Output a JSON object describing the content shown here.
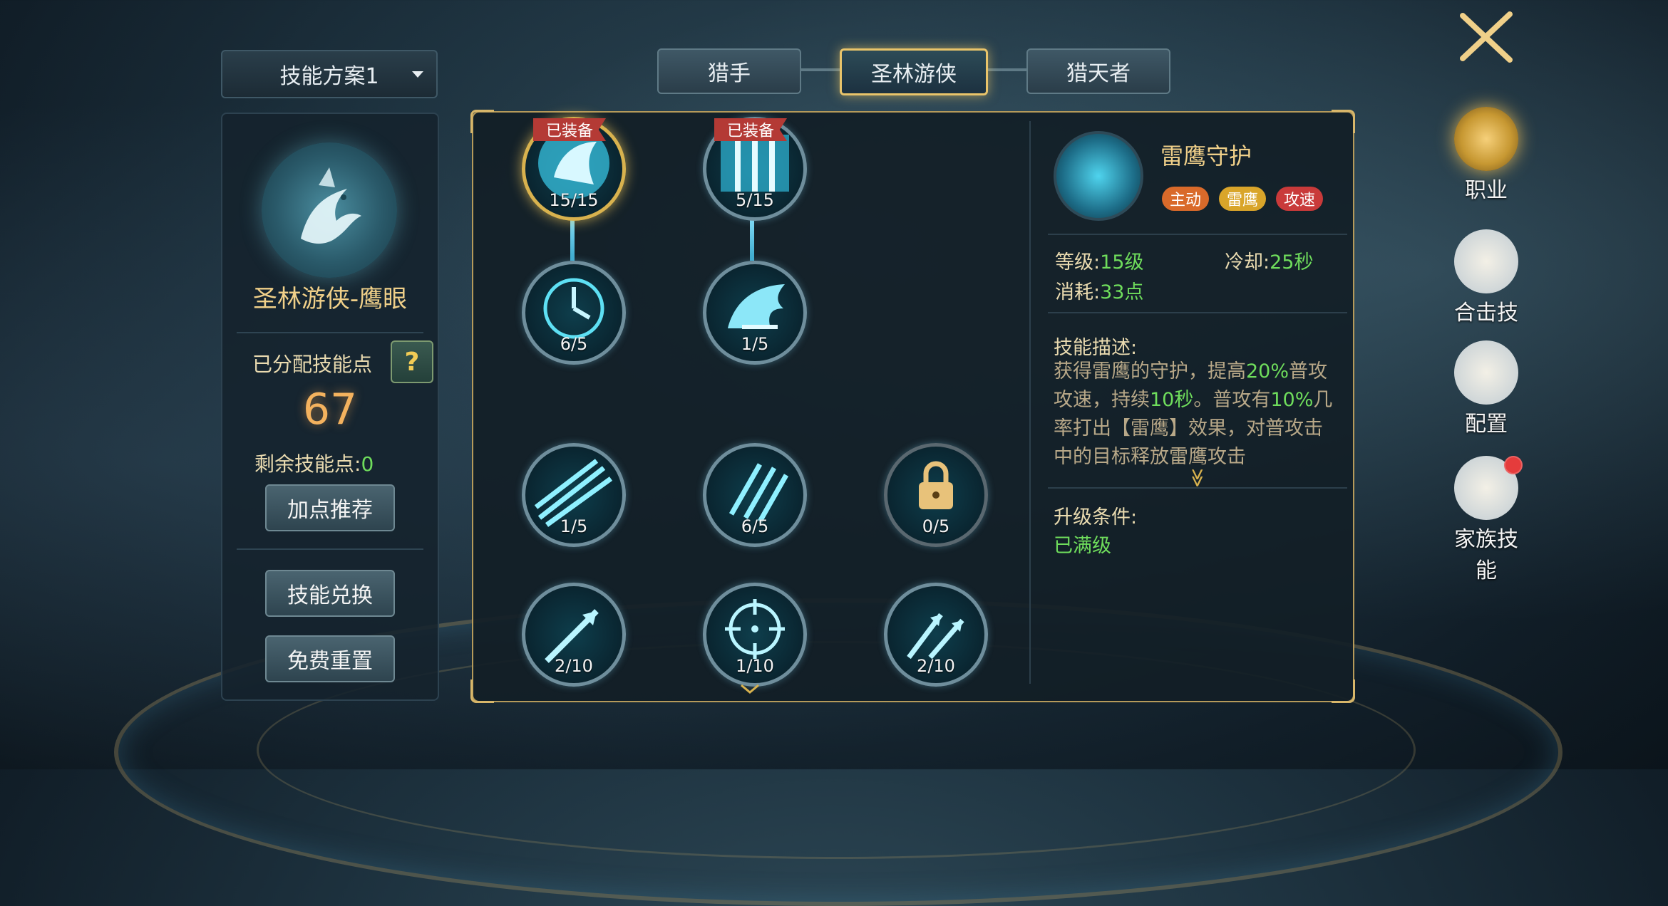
{
  "scheme": {
    "label": "技能方案1"
  },
  "left": {
    "class_name": "圣林游侠-鹰眼",
    "allocated_label": "已分配技能点",
    "help_glyph": "?",
    "allocated_points": "67",
    "remaining_label": "剩余技能点:",
    "remaining_points": "0",
    "recommend_btn": "加点推荐",
    "exchange_btn": "技能兑换",
    "reset_btn": "免费重置"
  },
  "tabs": [
    "猎手",
    "圣林游侠",
    "猎天者"
  ],
  "active_tab": "圣林游侠",
  "tree": {
    "equipped_badge": "已装备",
    "nodes": [
      {
        "id": "n1",
        "level": "15/15",
        "equipped": true,
        "selected": true,
        "icon": "thunder-hawk-icon"
      },
      {
        "id": "n2",
        "level": "5/15",
        "equipped": true,
        "icon": "light-rain-icon"
      },
      {
        "id": "n3",
        "level": "6/5",
        "icon": "clock-icon"
      },
      {
        "id": "n4",
        "level": "1/5",
        "icon": "wing-icon"
      },
      {
        "id": "n5",
        "level": "1/5",
        "icon": "multi-arrow-icon"
      },
      {
        "id": "n6",
        "level": "6/5",
        "icon": "arrow-rain-icon"
      },
      {
        "id": "n7",
        "level": "0/5",
        "locked": true,
        "icon": "lock-icon"
      },
      {
        "id": "n8",
        "level": "2/10",
        "icon": "piercing-arrow-icon"
      },
      {
        "id": "n9",
        "level": "1/10",
        "icon": "crosshair-icon"
      },
      {
        "id": "n10",
        "level": "2/10",
        "icon": "split-arrow-icon"
      }
    ]
  },
  "detail": {
    "name": "雷鹰守护",
    "tags": [
      {
        "text": "主动",
        "color": "#d96a2a"
      },
      {
        "text": "雷鹰",
        "color": "#d9a52a"
      },
      {
        "text": "攻速",
        "color": "#c93a3a"
      }
    ],
    "level_label": "等级:",
    "level_value": "15级",
    "cooldown_label": "冷却:",
    "cooldown_value": "25秒",
    "cost_label": "消耗:",
    "cost_value": "33点",
    "desc_title": "技能描述:",
    "desc_parts": [
      "获得雷鹰的守护，提高",
      "20%",
      "普攻攻速，持续",
      "10秒",
      "。普攻有",
      "10%",
      "几率打出【雷鹰】效果，对普攻击中的目标释放雷鹰攻击"
    ],
    "more_glyph": "≫",
    "upgrade_title": "升级条件:",
    "upgrade_value": "已满级"
  },
  "right_menu": [
    {
      "label": "职业",
      "icon": "sword-icon",
      "selected": true
    },
    {
      "label": "合击技",
      "icon": "book-icon"
    },
    {
      "label": "配置",
      "icon": "moon-icon"
    },
    {
      "label": "家族技能",
      "icon": "wolf-shield-icon",
      "notify": true
    }
  ]
}
